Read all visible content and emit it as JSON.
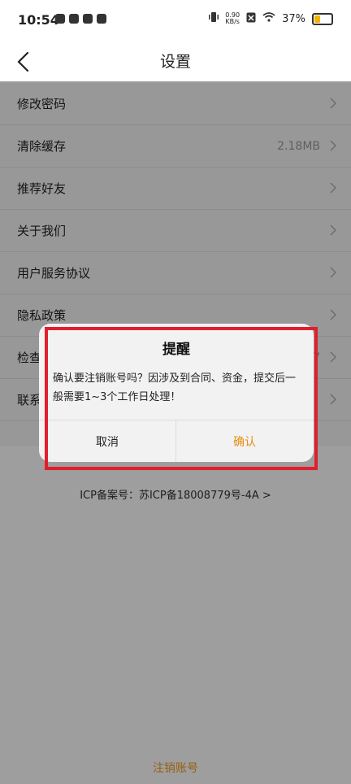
{
  "status_bar": {
    "time": "10:54",
    "net_speed_value": "0.90",
    "net_speed_unit": "KB/s",
    "battery": "37%",
    "battery_color": "#f0b400"
  },
  "navbar": {
    "title": "设置"
  },
  "settings": {
    "items": [
      {
        "label": "修改密码",
        "value": ""
      },
      {
        "label": "清除缓存",
        "value": "2.18MB"
      },
      {
        "label": "推荐好友",
        "value": ""
      },
      {
        "label": "关于我们",
        "value": ""
      },
      {
        "label": "用户服务协议",
        "value": ""
      },
      {
        "label": "隐私政策",
        "value": ""
      },
      {
        "label": "检查",
        "value": "7"
      },
      {
        "label": "联系",
        "value": ""
      }
    ]
  },
  "icp": {
    "text": "ICP备案号：苏ICP备18008779号-4A >"
  },
  "footer": {
    "deregister_label": "注销账号"
  },
  "dialog": {
    "title": "提醒",
    "message": "确认要注销账号吗？因涉及到合同、资金，提交后一般需要1~3个工作日处理！",
    "cancel_label": "取消",
    "confirm_label": "确认",
    "confirm_color": "#e88d14"
  },
  "highlight": {
    "color": "#e11f2c"
  }
}
